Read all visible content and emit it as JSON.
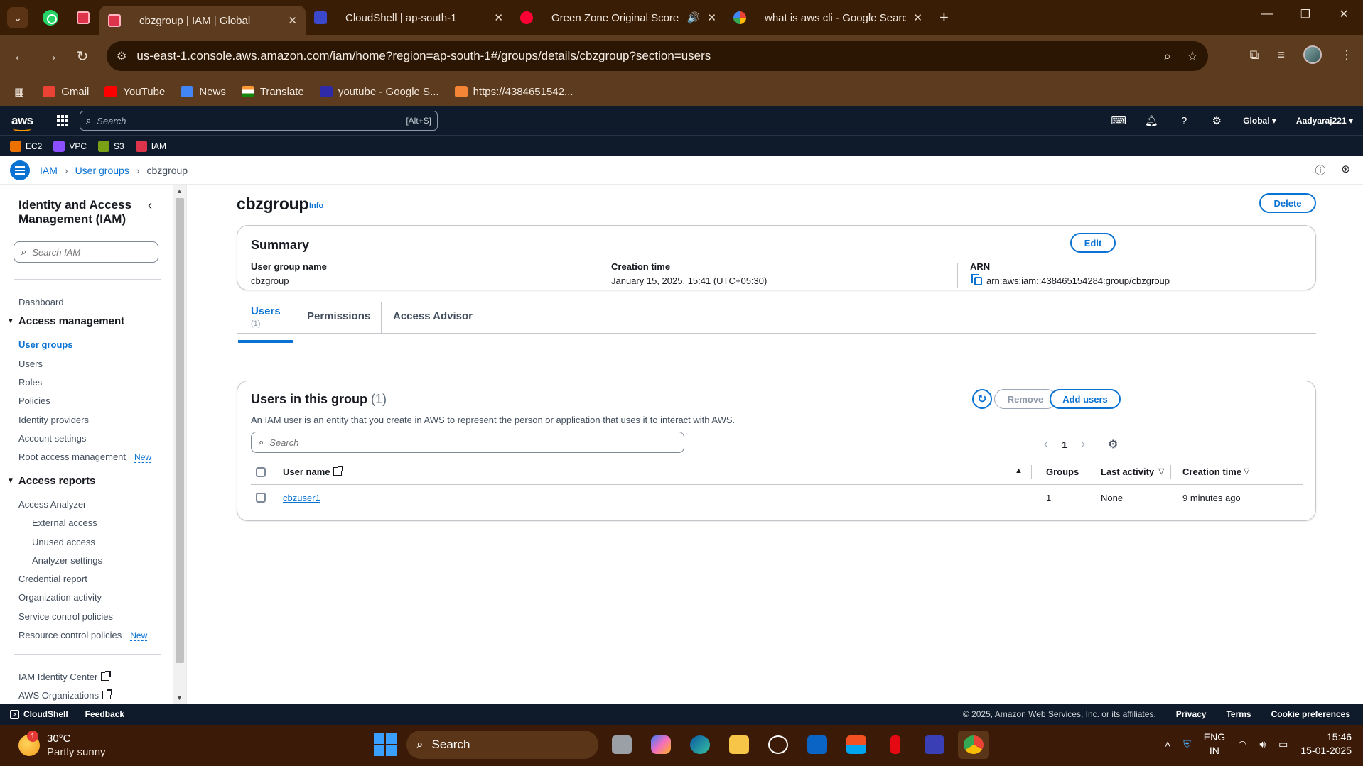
{
  "browser": {
    "tabs": [
      {
        "title": "cbzgroup | IAM | Global",
        "active": true
      },
      {
        "title": "CloudShell | ap-south-1",
        "active": false
      },
      {
        "title": "Green Zone Original Score",
        "active": false
      },
      {
        "title": "what is aws cli - Google Search",
        "active": false
      }
    ],
    "url": "us-east-1.console.aws.amazon.com/iam/home?region=ap-south-1#/groups/details/cbzgroup?section=users",
    "bookmarks": [
      {
        "label": "Gmail",
        "color": "#ea4335"
      },
      {
        "label": "YouTube",
        "color": "#ff0000"
      },
      {
        "label": "News",
        "color": "#4285f4"
      },
      {
        "label": "Translate",
        "color": "#ff9933"
      },
      {
        "label": "youtube - Google S...",
        "color": "#2e2aa8"
      },
      {
        "label": "https://4384651542...",
        "color": "#f58536"
      }
    ]
  },
  "aws": {
    "logo": "aws",
    "search_placeholder": "Search",
    "search_shortcut": "[Alt+S]",
    "region": "Global ▾",
    "account": "Aadyaraj221 ▾",
    "favorites": [
      {
        "label": "EC2",
        "color": "#ed7100"
      },
      {
        "label": "VPC",
        "color": "#8c4fff"
      },
      {
        "label": "S3",
        "color": "#7aa116"
      },
      {
        "label": "IAM",
        "color": "#dd344c"
      }
    ]
  },
  "breadcrumb": {
    "iam": "IAM",
    "groups": "User groups",
    "current": "cbzgroup"
  },
  "sidebar": {
    "title": "Identity and Access Management (IAM)",
    "search_placeholder": "Search IAM",
    "dashboard": "Dashboard",
    "access_management": "Access management",
    "am_items": [
      "User groups",
      "Users",
      "Roles",
      "Policies",
      "Identity providers",
      "Account settings",
      "Root access management"
    ],
    "access_reports": "Access reports",
    "ar_items": [
      "Access Analyzer",
      "External access",
      "Unused access",
      "Analyzer settings",
      "Credential report",
      "Organization activity",
      "Service control policies",
      "Resource control policies"
    ],
    "new_badge": "New",
    "bottom_items": [
      "IAM Identity Center",
      "AWS Organizations"
    ]
  },
  "page": {
    "title": "cbzgroup",
    "info": "Info",
    "delete": "Delete",
    "summary": {
      "heading": "Summary",
      "edit": "Edit",
      "group_name_label": "User group name",
      "group_name": "cbzgroup",
      "creation_label": "Creation time",
      "creation": "January 15, 2025, 15:41 (UTC+05:30)",
      "arn_label": "ARN",
      "arn": "arn:aws:iam::438465154284:group/cbzgroup"
    },
    "tabs": {
      "users": "Users",
      "users_count": "(1)",
      "permissions": "Permissions",
      "advisor": "Access Advisor"
    },
    "users_panel": {
      "title": "Users in this group",
      "count": "(1)",
      "description": "An IAM user is an entity that you create in AWS to represent the person or application that uses it to interact with AWS.",
      "remove": "Remove",
      "add": "Add users",
      "search_placeholder": "Search",
      "page": "1",
      "columns": {
        "name": "User name",
        "groups": "Groups",
        "last": "Last activity",
        "created": "Creation time"
      },
      "rows": [
        {
          "name": "cbzuser1",
          "groups": "1",
          "last": "None",
          "created": "9 minutes ago"
        }
      ]
    }
  },
  "footer": {
    "cloudshell": "CloudShell",
    "feedback": "Feedback",
    "copyright": "© 2025, Amazon Web Services, Inc. or its affiliates.",
    "privacy": "Privacy",
    "terms": "Terms",
    "cookies": "Cookie preferences"
  },
  "taskbar": {
    "temp": "30°C",
    "weather": "Partly sunny",
    "search": "Search",
    "lang1": "ENG",
    "lang2": "IN",
    "time": "15:46",
    "date": "15-01-2025",
    "notif": "1"
  }
}
